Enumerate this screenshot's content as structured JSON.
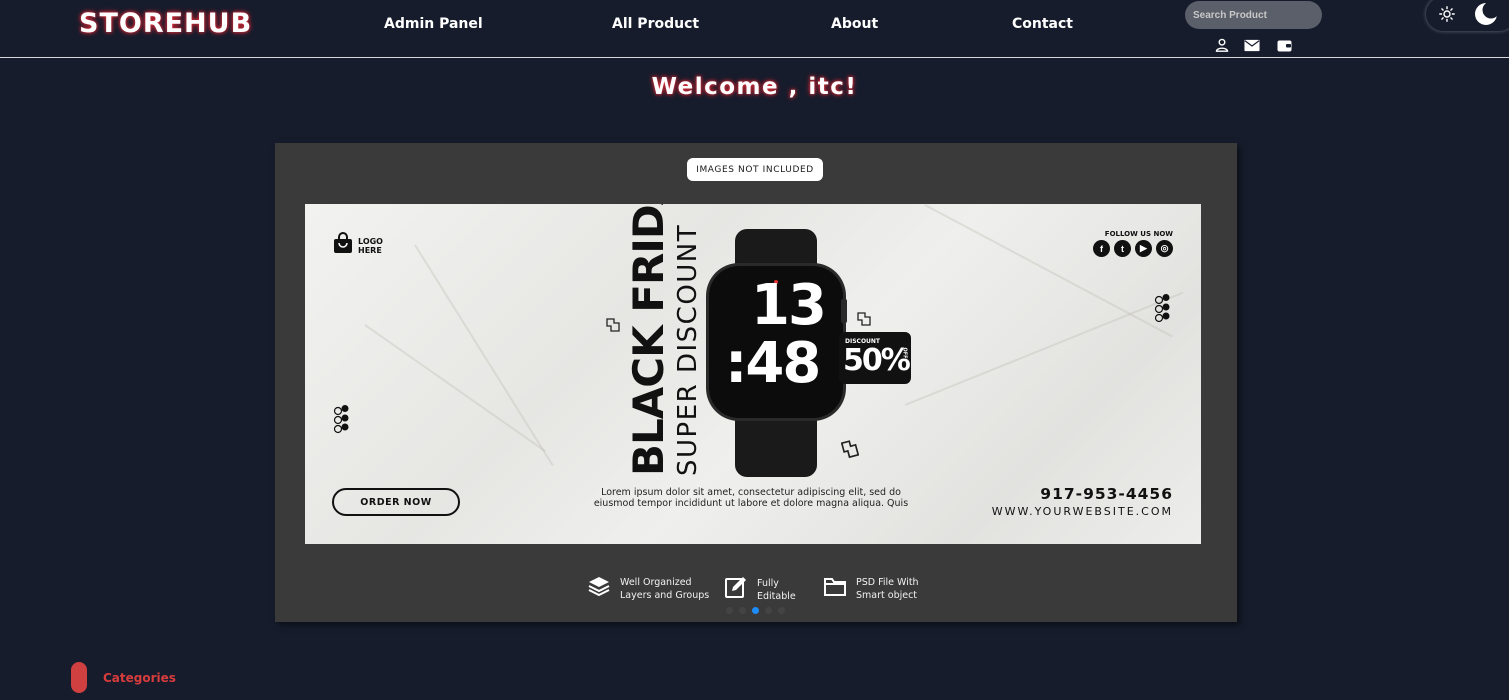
{
  "header": {
    "brand": "STOREHUB",
    "nav": [
      {
        "label": "Admin Panel"
      },
      {
        "label": "All Product"
      },
      {
        "label": "About"
      },
      {
        "label": "Contact"
      }
    ],
    "search": {
      "placeholder": "Search Product",
      "value": ""
    },
    "icons": [
      "user-icon",
      "mail-icon",
      "wallet-icon"
    ],
    "theme": {
      "light_icon": "sun-icon",
      "dark_icon": "moon-icon"
    }
  },
  "welcome": {
    "text": "Welcome , itc!"
  },
  "carousel": {
    "pill": "IMAGES NOT INCLUDED",
    "banner": {
      "logo_line1": "LOGO",
      "logo_line2": "HERE",
      "follow_label": "FOLLOW US NOW",
      "social": [
        {
          "icon": "facebook-icon",
          "glyph": "f"
        },
        {
          "icon": "twitter-icon",
          "glyph": "t"
        },
        {
          "icon": "youtube-icon",
          "glyph": "▶"
        },
        {
          "icon": "instagram-icon",
          "glyph": "◎"
        }
      ],
      "headline": "BLACK FRIDAY",
      "subheadline": "SUPER DISCOUNT",
      "watch_hour": "13",
      "watch_minute": ":48",
      "badge_label": "DISCOUNT",
      "badge_percent": "50%",
      "badge_off": "OFF",
      "lorem": "Lorem ipsum dolor sit amet, consectetur adipiscing elit, sed do eiusmod tempor incididunt ut labore et dolore magna aliqua. Quis",
      "order_button": "ORDER NOW",
      "phone": "917-953-4456",
      "website": "WWW.YOURWEBSITE.COM"
    },
    "features": [
      {
        "icon": "layers-icon",
        "line1": "Well Organized",
        "line2": "Layers and Groups"
      },
      {
        "icon": "edit-icon",
        "line1": "Fully",
        "line2": "Editable"
      },
      {
        "icon": "folder-icon",
        "line1": "PSD File With",
        "line2": "Smart object"
      }
    ],
    "slide_count": 5,
    "active_slide": 3,
    "colors": {
      "active_indicator": "#1d8cf8",
      "panel": "#3a3a3a"
    }
  },
  "categories": {
    "label": "Categories",
    "accent": "#d04040"
  },
  "colors": {
    "background": "#161c2c",
    "brand_glow": "#e0303a"
  }
}
